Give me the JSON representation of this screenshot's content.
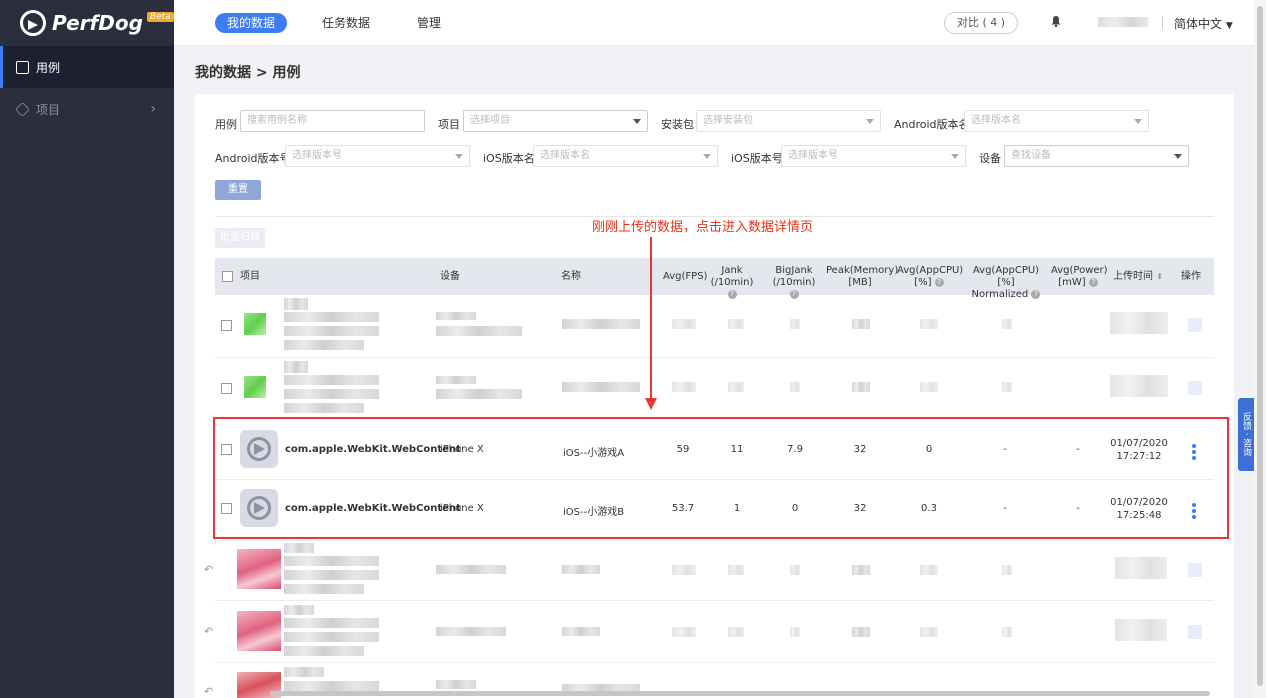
{
  "app": {
    "logo": "PerfDog",
    "beta": "Beta"
  },
  "sidebar": {
    "items": [
      {
        "label": "用例",
        "icon": "list-icon"
      },
      {
        "label": "项目",
        "icon": "cube-icon"
      }
    ]
  },
  "topbar": {
    "tabs": [
      "我的数据",
      "任务数据",
      "管理"
    ],
    "compare": "对比 ( 4 )",
    "language": "简体中文"
  },
  "breadcrumb": "我的数据 > 用例",
  "filters": {
    "case_label": "用例",
    "case_placeholder": "搜索用例名称",
    "project_label": "项目",
    "project_placeholder": "选择项目",
    "package_label": "安装包",
    "package_placeholder": "选择安装包",
    "android_ver_name_label": "Android版本名",
    "android_ver_name_placeholder": "选择版本名",
    "android_ver_code_label": "Android版本号",
    "android_ver_code_placeholder": "选择版本号",
    "ios_ver_name_label": "iOS版本名",
    "ios_ver_name_placeholder": "选择版本名",
    "ios_ver_code_label": "iOS版本号",
    "ios_ver_code_placeholder": "选择版本号",
    "device_label": "设备",
    "device_placeholder": "查找设备",
    "reset": "重置"
  },
  "bulk_button": "批量归档",
  "annotation": "刚刚上传的数据，点击进入数据详情页",
  "feedback": "反馈 · 咨询",
  "table": {
    "headers": {
      "project": "项目",
      "device": "设备",
      "name": "名称",
      "fps": "Avg(FPS)",
      "jank1": "Jank",
      "jank2": "(/10min)",
      "bigjank1": "BigJank",
      "bigjank2": "(/10min)",
      "mem1": "Peak(Memory)",
      "mem2": "[MB]",
      "cpu1": "Avg(AppCPU)",
      "cpu2": "[%]",
      "cpun1": "Avg(AppCPU)[%]",
      "cpun2": "Normalized",
      "power1": "Avg(Power)",
      "power2": "[mW]",
      "time": "上传时间",
      "op": "操作"
    },
    "rows": [
      {
        "project": "com.apple.WebKit.WebContent",
        "device": "iPhone X",
        "name": "iOS--小游戏A",
        "fps": "59",
        "jank": "11",
        "bigjank": "7.9",
        "memory": "32",
        "cpu": "0",
        "cpu_norm": "-",
        "power": "-",
        "date": "01/07/2020",
        "time": "17:27:12"
      },
      {
        "project": "com.apple.WebKit.WebContent",
        "device": "iPhone X",
        "name": "iOS--小游戏B",
        "fps": "53.7",
        "jank": "1",
        "bigjank": "0",
        "memory": "32",
        "cpu": "0.3",
        "cpu_norm": "-",
        "power": "-",
        "date": "01/07/2020",
        "time": "17:25:48"
      }
    ]
  }
}
